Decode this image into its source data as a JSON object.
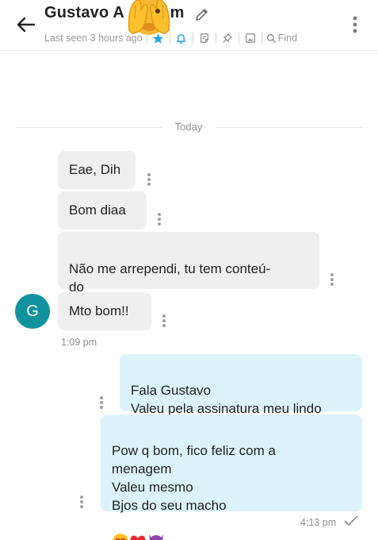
{
  "header": {
    "contact_name": "Gustavo A          m",
    "last_seen": "Last seen 3 hours ago",
    "find_label": "Find",
    "icons": [
      "back-arrow-icon",
      "see-no-evil-emoji-icon",
      "pencil-icon",
      "star-icon",
      "bell-icon",
      "sticker-icon",
      "pin-icon",
      "image-icon",
      "search-icon",
      "more-vertical-icon"
    ]
  },
  "chat": {
    "date_divider": "Today",
    "incoming": {
      "avatar_letter": "G",
      "messages": [
        "Eae, Dih",
        "Bom diaa",
        "Não me arrependi, tu tem conteú-\ndo",
        "Mto bom!!"
      ],
      "time": "1:09 pm"
    },
    "outgoing": {
      "messages": [
        "Fala Gustavo\nValeu pela assinatura meu lindo",
        "Pow q bom, fico feliz com a\nmenagem\nValeu mesmo\nBjos do seu macho"
      ],
      "emojis": [
        "heart-eyes-emoji",
        "red-heart-emoji",
        "smiling-devil-emoji"
      ],
      "time": "4:13 pm"
    }
  },
  "colors": {
    "accent": "#1fa3e6",
    "avatar_bg": "#11939f",
    "incoming_bubble": "#efefef",
    "outgoing_bubble": "#dcf3fb",
    "muted_text": "#8e8e8e"
  }
}
